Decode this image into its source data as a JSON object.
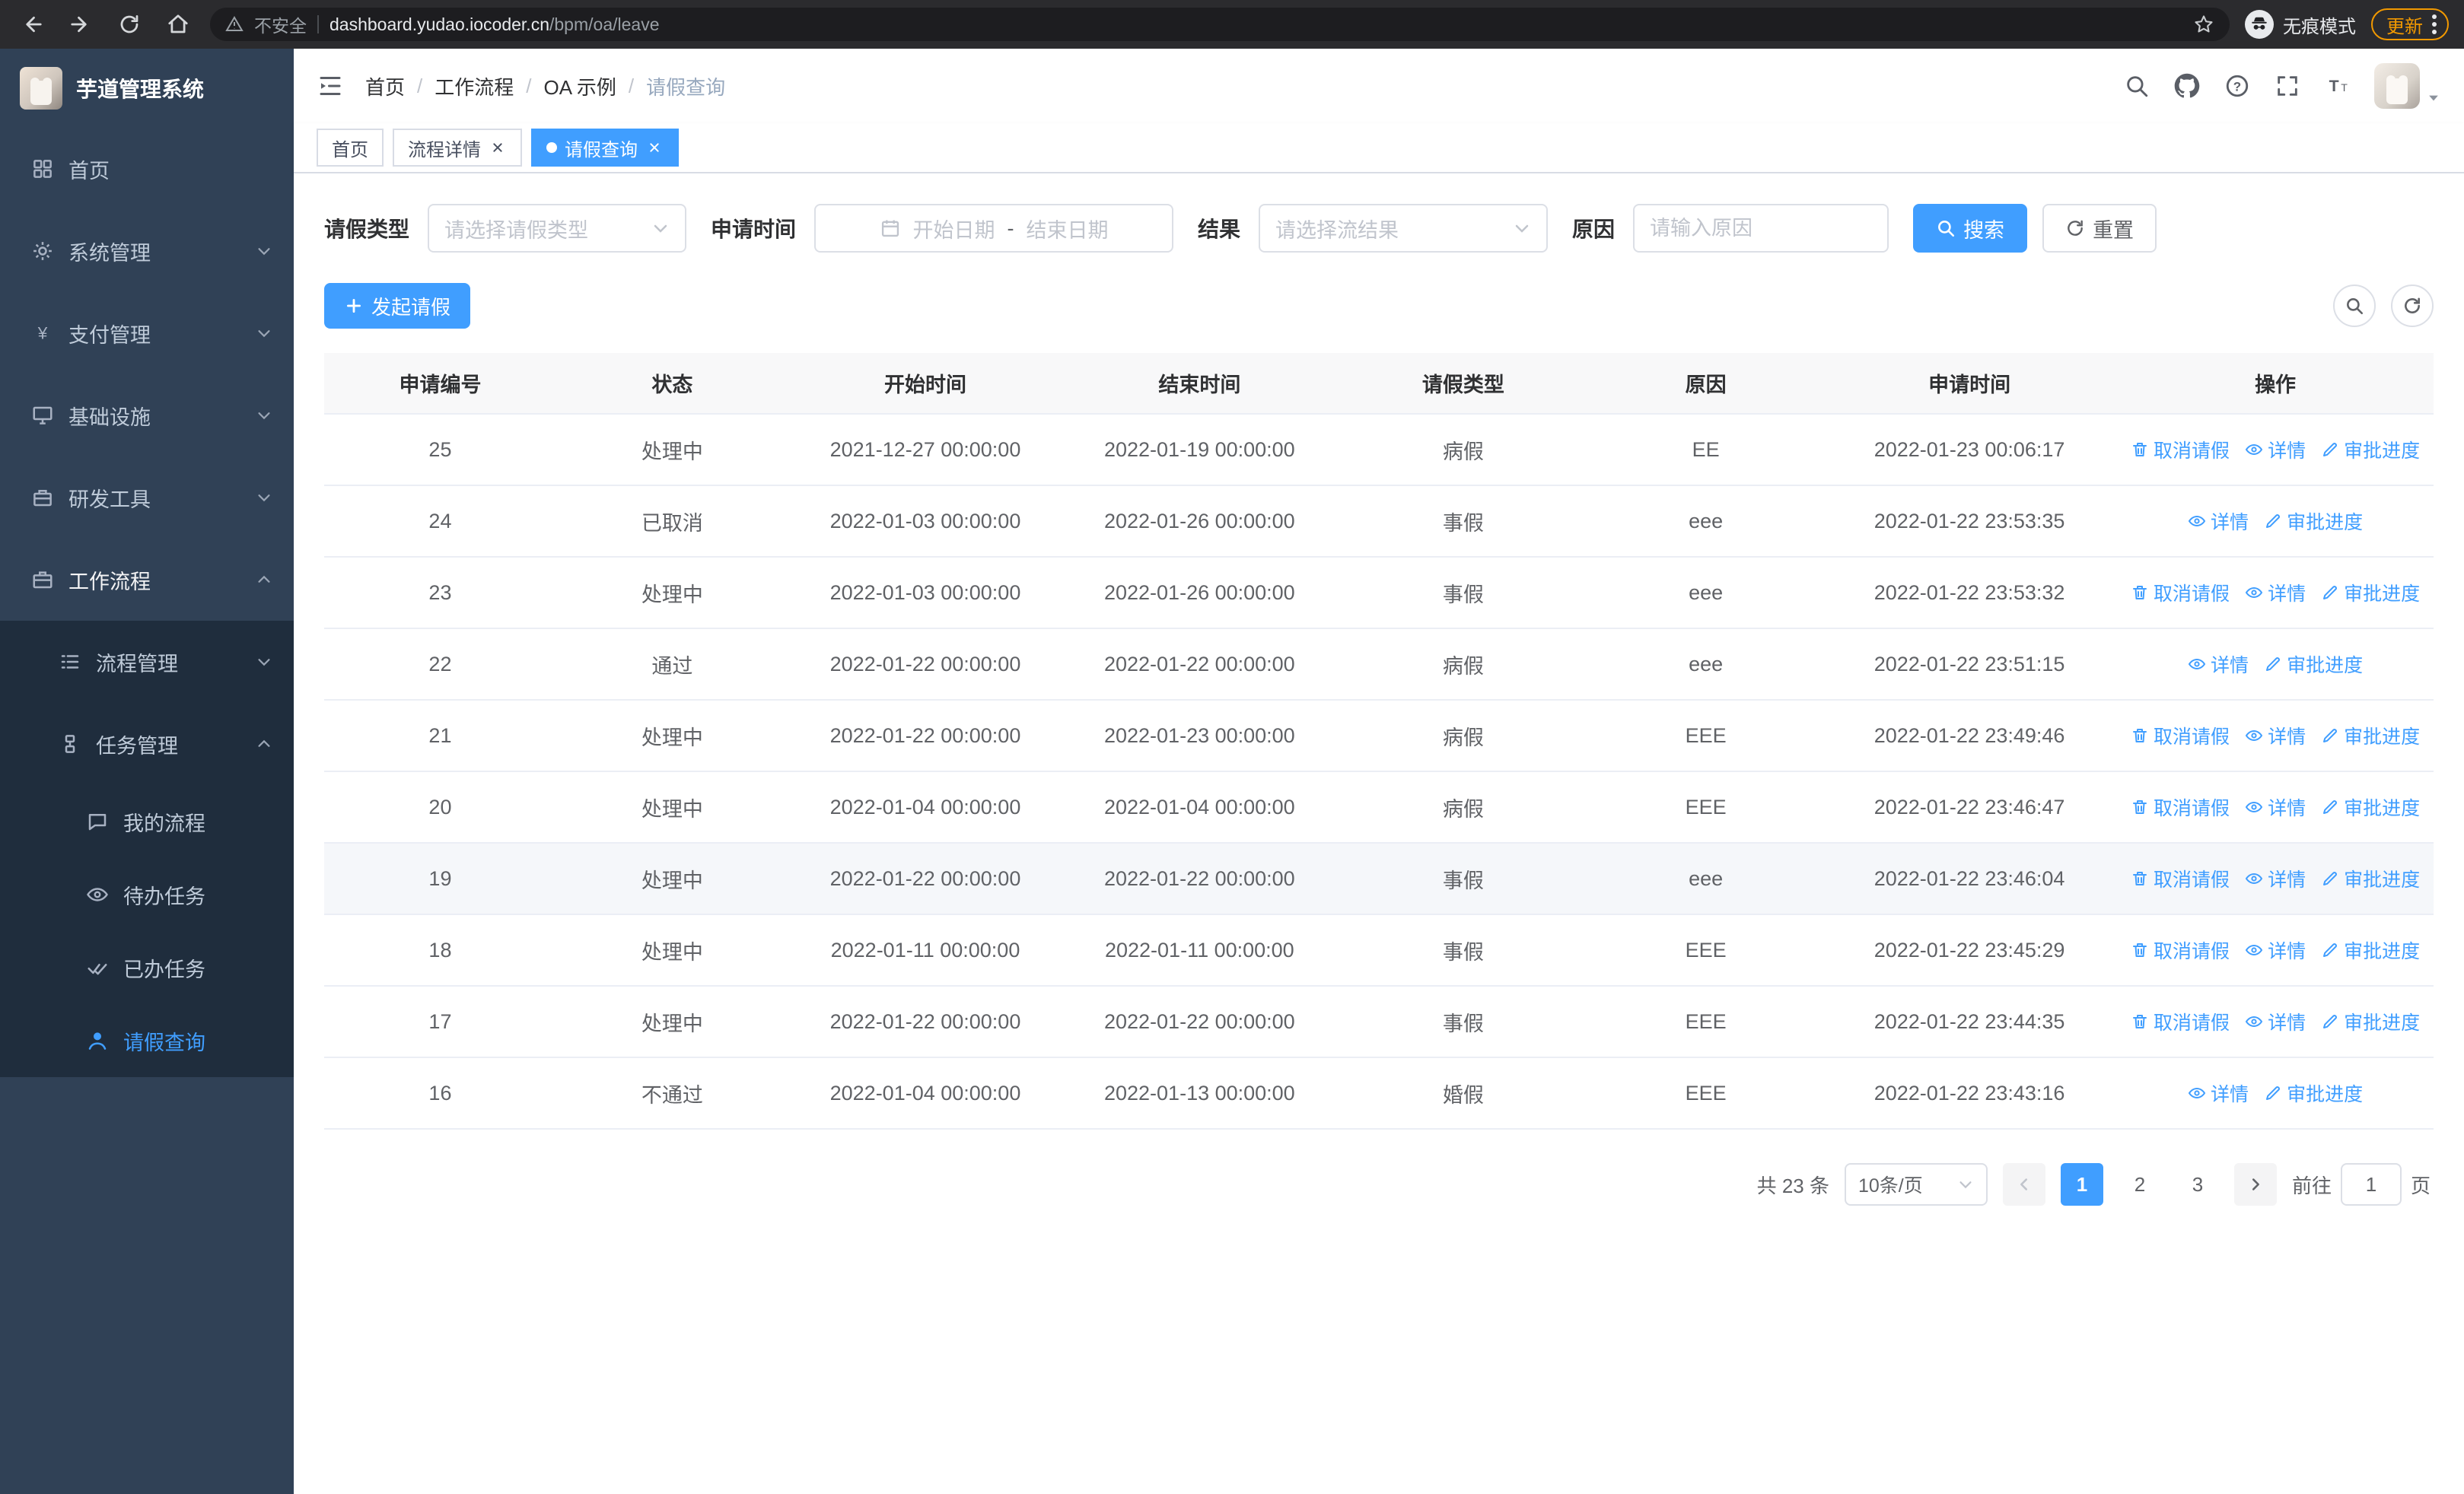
{
  "browser": {
    "security_label": "不安全",
    "url_domain": "dashboard.yudao.iocoder.cn",
    "url_path": "/bpm/oa/leave",
    "incognito_label": "无痕模式",
    "update_label": "更新"
  },
  "sidebar": {
    "logo_title": "芋道管理系统",
    "items": [
      {
        "label": "首页"
      },
      {
        "label": "系统管理"
      },
      {
        "label": "支付管理"
      },
      {
        "label": "基础设施"
      },
      {
        "label": "研发工具"
      },
      {
        "label": "工作流程"
      },
      {
        "label": "流程管理"
      },
      {
        "label": "任务管理"
      },
      {
        "label": "我的流程"
      },
      {
        "label": "待办任务"
      },
      {
        "label": "已办任务"
      },
      {
        "label": "请假查询"
      }
    ]
  },
  "breadcrumb": [
    "首页",
    "工作流程",
    "OA 示例",
    "请假查询"
  ],
  "tabs": [
    {
      "label": "首页"
    },
    {
      "label": "流程详情"
    },
    {
      "label": "请假查询"
    }
  ],
  "filters": {
    "leave_type_label": "请假类型",
    "leave_type_placeholder": "请选择请假类型",
    "apply_time_label": "申请时间",
    "date_start_placeholder": "开始日期",
    "date_separator": "-",
    "date_end_placeholder": "结束日期",
    "result_label": "结果",
    "result_placeholder": "请选择流结果",
    "reason_label": "原因",
    "reason_placeholder": "请输入原因",
    "search_label": "搜索",
    "reset_label": "重置"
  },
  "toolbar": {
    "create_label": "发起请假"
  },
  "table": {
    "columns": [
      "申请编号",
      "状态",
      "开始时间",
      "结束时间",
      "请假类型",
      "原因",
      "申请时间",
      "操作"
    ],
    "action_labels": {
      "cancel": "取消请假",
      "detail": "详情",
      "progress": "审批进度"
    },
    "rows": [
      {
        "id": "25",
        "status": "处理中",
        "start_time": "2021-12-27 00:00:00",
        "end_time": "2022-01-19 00:00:00",
        "leave_type": "病假",
        "reason": "EE",
        "apply_time": "2022-01-23 00:06:17",
        "actions": [
          "cancel",
          "detail",
          "progress"
        ],
        "highlighted": false
      },
      {
        "id": "24",
        "status": "已取消",
        "start_time": "2022-01-03 00:00:00",
        "end_time": "2022-01-26 00:00:00",
        "leave_type": "事假",
        "reason": "eee",
        "apply_time": "2022-01-22 23:53:35",
        "actions": [
          "detail",
          "progress"
        ],
        "highlighted": false
      },
      {
        "id": "23",
        "status": "处理中",
        "start_time": "2022-01-03 00:00:00",
        "end_time": "2022-01-26 00:00:00",
        "leave_type": "事假",
        "reason": "eee",
        "apply_time": "2022-01-22 23:53:32",
        "actions": [
          "cancel",
          "detail",
          "progress"
        ],
        "highlighted": false
      },
      {
        "id": "22",
        "status": "通过",
        "start_time": "2022-01-22 00:00:00",
        "end_time": "2022-01-22 00:00:00",
        "leave_type": "病假",
        "reason": "eee",
        "apply_time": "2022-01-22 23:51:15",
        "actions": [
          "detail",
          "progress"
        ],
        "highlighted": false
      },
      {
        "id": "21",
        "status": "处理中",
        "start_time": "2022-01-22 00:00:00",
        "end_time": "2022-01-23 00:00:00",
        "leave_type": "病假",
        "reason": "EEE",
        "apply_time": "2022-01-22 23:49:46",
        "actions": [
          "cancel",
          "detail",
          "progress"
        ],
        "highlighted": false
      },
      {
        "id": "20",
        "status": "处理中",
        "start_time": "2022-01-04 00:00:00",
        "end_time": "2022-01-04 00:00:00",
        "leave_type": "病假",
        "reason": "EEE",
        "apply_time": "2022-01-22 23:46:47",
        "actions": [
          "cancel",
          "detail",
          "progress"
        ],
        "highlighted": false
      },
      {
        "id": "19",
        "status": "处理中",
        "start_time": "2022-01-22 00:00:00",
        "end_time": "2022-01-22 00:00:00",
        "leave_type": "事假",
        "reason": "eee",
        "apply_time": "2022-01-22 23:46:04",
        "actions": [
          "cancel",
          "detail",
          "progress"
        ],
        "highlighted": true
      },
      {
        "id": "18",
        "status": "处理中",
        "start_time": "2022-01-11 00:00:00",
        "end_time": "2022-01-11 00:00:00",
        "leave_type": "事假",
        "reason": "EEE",
        "apply_time": "2022-01-22 23:45:29",
        "actions": [
          "cancel",
          "detail",
          "progress"
        ],
        "highlighted": false
      },
      {
        "id": "17",
        "status": "处理中",
        "start_time": "2022-01-22 00:00:00",
        "end_time": "2022-01-22 00:00:00",
        "leave_type": "事假",
        "reason": "EEE",
        "apply_time": "2022-01-22 23:44:35",
        "actions": [
          "cancel",
          "detail",
          "progress"
        ],
        "highlighted": false
      },
      {
        "id": "16",
        "status": "不通过",
        "start_time": "2022-01-04 00:00:00",
        "end_time": "2022-01-13 00:00:00",
        "leave_type": "婚假",
        "reason": "EEE",
        "apply_time": "2022-01-22 23:43:16",
        "actions": [
          "detail",
          "progress"
        ],
        "highlighted": false
      }
    ]
  },
  "pagination": {
    "total_label": "共 23 条",
    "page_size_label": "10条/页",
    "pages": [
      "1",
      "2",
      "3"
    ],
    "active_page": "1",
    "goto_prefix": "前往",
    "goto_value": "1",
    "goto_suffix": "页"
  }
}
